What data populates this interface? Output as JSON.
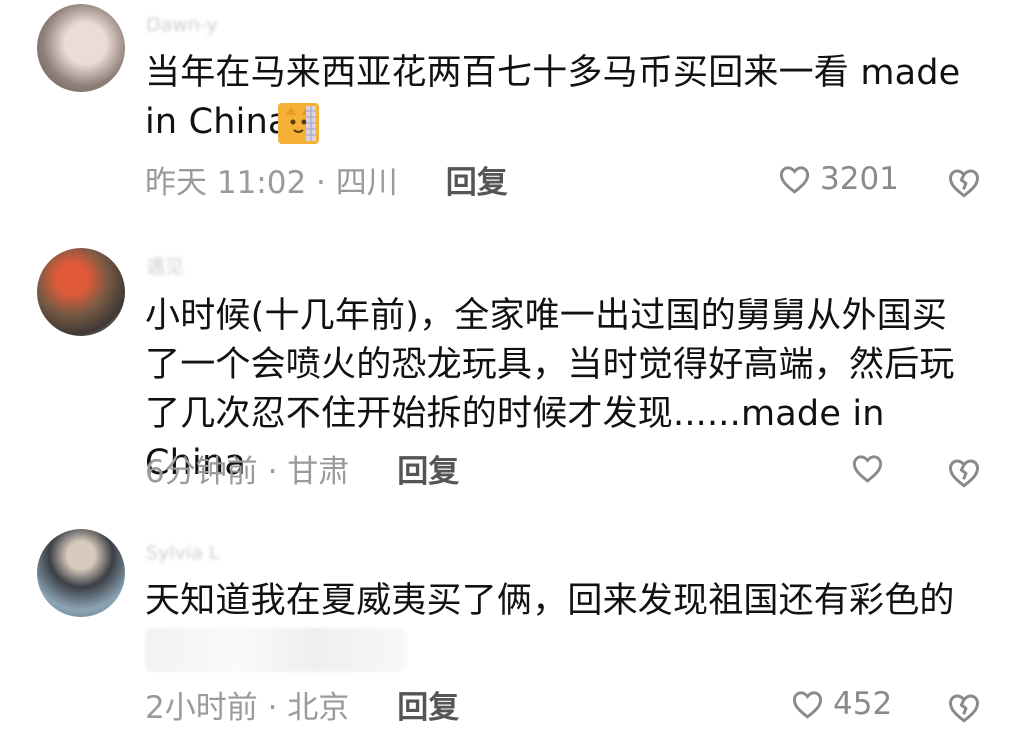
{
  "comments": [
    {
      "username": "Dawn-y",
      "text": "当年在马来西亚花两百七十多马币买回来一看 made\nin China",
      "emoji": "cat-face-icon",
      "time_location": "昨天 11:02 · 四川",
      "reply_label": "回复",
      "likes": "3201"
    },
    {
      "username": "遇见",
      "text": "小时候(十几年前)，全家唯一出过国的舅舅从外国买\n了一个会喷火的恐龙玩具，当时觉得好高端，然后玩\n了几次忍不住开始拆的时候才发现......made in China",
      "time_location": "6分钟前 · 甘肃",
      "reply_label": "回复",
      "likes": ""
    },
    {
      "username": "Sylvia L",
      "text": "天知道我在夏威夷买了俩，回来发现祖国还有彩色的",
      "time_location": "2小时前 · 北京",
      "reply_label": "回复",
      "likes": "452"
    }
  ],
  "icons": {
    "like": "heart-outline-icon",
    "dislike": "broken-heart-outline-icon"
  },
  "colors": {
    "meta_text": "#9a9a9a",
    "reply_text": "#555555",
    "username_text": "#cfcfcf",
    "body_text": "#111111"
  }
}
